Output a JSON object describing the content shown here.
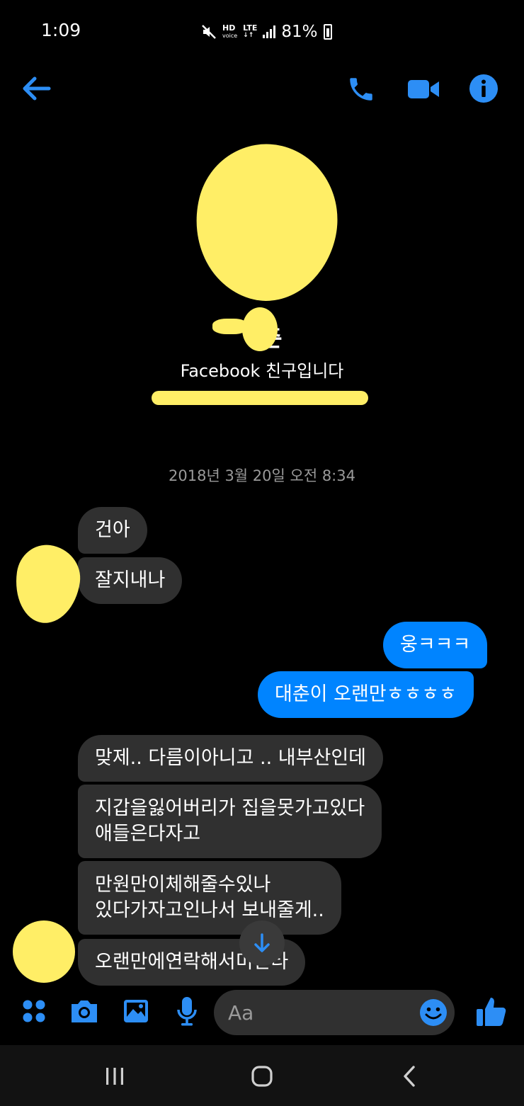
{
  "status": {
    "time": "1:09",
    "hd": "HD",
    "voice": "voice",
    "lte": "LTE",
    "battery": "81%"
  },
  "header": {
    "back_icon": "arrow-left-icon",
    "call_icon": "phone-icon",
    "video_icon": "video-camera-icon",
    "info_icon": "info-icon"
  },
  "profile": {
    "name_visible": "춘",
    "subtitle": "Facebook 친구입니다"
  },
  "conversation": {
    "timestamp": "2018년 3월 20일 오전 8:34",
    "messages": [
      {
        "from": "them",
        "text": "건아"
      },
      {
        "from": "them",
        "text": "잘지내나"
      },
      {
        "from": "me",
        "text": "웅ㅋㅋㅋ"
      },
      {
        "from": "me",
        "text": "대춘이 오랜만ㅎㅎㅎㅎ"
      },
      {
        "from": "them",
        "text": "맞제.. 다름이아니고 .. 내부산인데"
      },
      {
        "from": "them",
        "text": "지갑을잃어버리가 집을못가고있다\n애들은다자고"
      },
      {
        "from": "them",
        "text": "만원만이체해줄수있나\n있다가자고인나서 보내줄게.."
      },
      {
        "from": "them",
        "text": "오랜만에연락해서미안타"
      }
    ]
  },
  "composer": {
    "placeholder": "Aa",
    "icons": [
      "apps-icon",
      "camera-icon",
      "image-icon",
      "microphone-icon",
      "emoji-icon",
      "thumbs-up-icon"
    ]
  },
  "colors": {
    "accent": "#0084ff",
    "incoming_bubble": "#303030",
    "background": "#000000",
    "redaction": "#ffee66"
  }
}
